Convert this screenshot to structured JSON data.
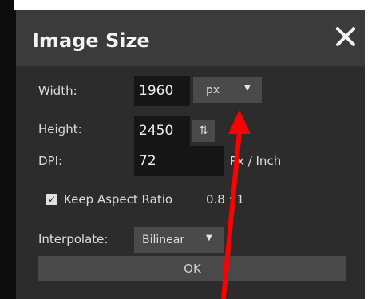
{
  "dialog": {
    "title": "Image Size",
    "close_icon": "close-icon"
  },
  "width": {
    "label": "Width:",
    "value": "1960",
    "unit": "px"
  },
  "height": {
    "label": "Height:",
    "value": "2450",
    "swap_glyph": "⇅"
  },
  "dpi": {
    "label": "DPI:",
    "value": "72",
    "unit_label": "Px / Inch"
  },
  "aspect": {
    "label": "Keep Aspect Ratio",
    "checked": true,
    "ratio": "0.8 : 1"
  },
  "interpolate": {
    "label": "Interpolate:",
    "value": "Bilinear"
  },
  "ok_label": "OK",
  "colors": {
    "dialog_bg": "#2c2c2c",
    "title_bar": "#3b3b3b",
    "input_bg": "#161616",
    "control_bg": "#4a4a4a",
    "annotation_arrow": "#ff0000"
  }
}
